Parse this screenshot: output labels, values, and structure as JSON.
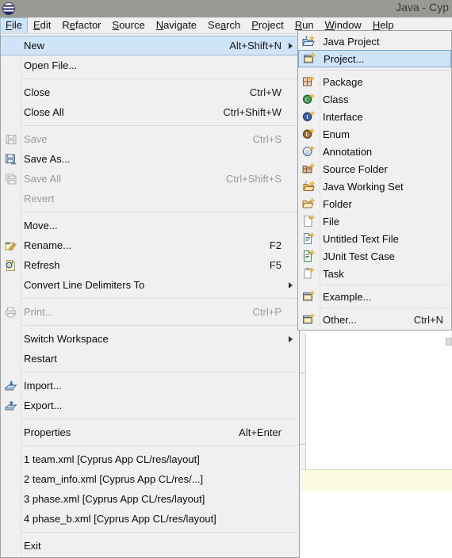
{
  "window": {
    "title": "Java - Cyp",
    "logo_icon": "eclipse-logo-icon"
  },
  "menubar": {
    "items": [
      {
        "label": "File",
        "mnemonic_index": 0,
        "active": true
      },
      {
        "label": "Edit",
        "mnemonic_index": 0,
        "active": false
      },
      {
        "label": "Refactor",
        "mnemonic_index": 1,
        "active": false
      },
      {
        "label": "Source",
        "mnemonic_index": 0,
        "active": false
      },
      {
        "label": "Navigate",
        "mnemonic_index": 0,
        "active": false
      },
      {
        "label": "Search",
        "mnemonic_index": 2,
        "active": false
      },
      {
        "label": "Project",
        "mnemonic_index": 0,
        "active": false
      },
      {
        "label": "Run",
        "mnemonic_index": 0,
        "active": false
      },
      {
        "label": "Window",
        "mnemonic_index": 0,
        "active": false
      },
      {
        "label": "Help",
        "mnemonic_index": 0,
        "active": false
      }
    ]
  },
  "file_menu": {
    "items": [
      {
        "type": "item",
        "label": "New",
        "accel": "Alt+Shift+N",
        "submenu": true,
        "enabled": true,
        "selected": true,
        "icon": ""
      },
      {
        "type": "item",
        "label": "Open File...",
        "accel": "",
        "submenu": false,
        "enabled": true,
        "selected": false,
        "icon": ""
      },
      {
        "type": "sep"
      },
      {
        "type": "item",
        "label": "Close",
        "accel": "Ctrl+W",
        "submenu": false,
        "enabled": true,
        "selected": false,
        "icon": ""
      },
      {
        "type": "item",
        "label": "Close All",
        "accel": "Ctrl+Shift+W",
        "submenu": false,
        "enabled": true,
        "selected": false,
        "icon": ""
      },
      {
        "type": "sep"
      },
      {
        "type": "item",
        "label": "Save",
        "accel": "Ctrl+S",
        "submenu": false,
        "enabled": false,
        "selected": false,
        "icon": "save-icon"
      },
      {
        "type": "item",
        "label": "Save As...",
        "accel": "",
        "submenu": false,
        "enabled": true,
        "selected": false,
        "icon": "save-as-icon"
      },
      {
        "type": "item",
        "label": "Save All",
        "accel": "Ctrl+Shift+S",
        "submenu": false,
        "enabled": false,
        "selected": false,
        "icon": "save-all-icon"
      },
      {
        "type": "item",
        "label": "Revert",
        "accel": "",
        "submenu": false,
        "enabled": false,
        "selected": false,
        "icon": ""
      },
      {
        "type": "sep"
      },
      {
        "type": "item",
        "label": "Move...",
        "accel": "",
        "submenu": false,
        "enabled": true,
        "selected": false,
        "icon": ""
      },
      {
        "type": "item",
        "label": "Rename...",
        "accel": "F2",
        "submenu": false,
        "enabled": true,
        "selected": false,
        "icon": "rename-icon"
      },
      {
        "type": "item",
        "label": "Refresh",
        "accel": "F5",
        "submenu": false,
        "enabled": true,
        "selected": false,
        "icon": "refresh-icon"
      },
      {
        "type": "item",
        "label": "Convert Line Delimiters To",
        "accel": "",
        "submenu": true,
        "enabled": true,
        "selected": false,
        "icon": ""
      },
      {
        "type": "sep"
      },
      {
        "type": "item",
        "label": "Print...",
        "accel": "Ctrl+P",
        "submenu": false,
        "enabled": false,
        "selected": false,
        "icon": "print-icon"
      },
      {
        "type": "sep"
      },
      {
        "type": "item",
        "label": "Switch Workspace",
        "accel": "",
        "submenu": true,
        "enabled": true,
        "selected": false,
        "icon": ""
      },
      {
        "type": "item",
        "label": "Restart",
        "accel": "",
        "submenu": false,
        "enabled": true,
        "selected": false,
        "icon": ""
      },
      {
        "type": "sep"
      },
      {
        "type": "item",
        "label": "Import...",
        "accel": "",
        "submenu": false,
        "enabled": true,
        "selected": false,
        "icon": "import-icon"
      },
      {
        "type": "item",
        "label": "Export...",
        "accel": "",
        "submenu": false,
        "enabled": true,
        "selected": false,
        "icon": "export-icon"
      },
      {
        "type": "sep"
      },
      {
        "type": "item",
        "label": "Properties",
        "accel": "Alt+Enter",
        "submenu": false,
        "enabled": true,
        "selected": false,
        "icon": ""
      },
      {
        "type": "sep"
      },
      {
        "type": "item",
        "label": "1 team.xml  [Cyprus App CL/res/layout]",
        "accel": "",
        "submenu": false,
        "enabled": true,
        "selected": false,
        "icon": ""
      },
      {
        "type": "item",
        "label": "2 team_info.xml  [Cyprus App CL/res/...]",
        "accel": "",
        "submenu": false,
        "enabled": true,
        "selected": false,
        "icon": ""
      },
      {
        "type": "item",
        "label": "3 phase.xml  [Cyprus App CL/res/layout]",
        "accel": "",
        "submenu": false,
        "enabled": true,
        "selected": false,
        "icon": ""
      },
      {
        "type": "item",
        "label": "4 phase_b.xml  [Cyprus App CL/res/layout]",
        "accel": "",
        "submenu": false,
        "enabled": true,
        "selected": false,
        "icon": ""
      },
      {
        "type": "sep"
      },
      {
        "type": "item",
        "label": "Exit",
        "accel": "",
        "submenu": false,
        "enabled": true,
        "selected": false,
        "icon": ""
      }
    ]
  },
  "new_submenu": {
    "items": [
      {
        "type": "item",
        "label": "Java Project",
        "accel": "",
        "selected": false,
        "icon": "java-project-icon"
      },
      {
        "type": "item",
        "label": "Project...",
        "accel": "",
        "selected": true,
        "icon": "project-icon"
      },
      {
        "type": "sep"
      },
      {
        "type": "item",
        "label": "Package",
        "accel": "",
        "selected": false,
        "icon": "package-icon"
      },
      {
        "type": "item",
        "label": "Class",
        "accel": "",
        "selected": false,
        "icon": "class-icon"
      },
      {
        "type": "item",
        "label": "Interface",
        "accel": "",
        "selected": false,
        "icon": "interface-icon"
      },
      {
        "type": "item",
        "label": "Enum",
        "accel": "",
        "selected": false,
        "icon": "enum-icon"
      },
      {
        "type": "item",
        "label": "Annotation",
        "accel": "",
        "selected": false,
        "icon": "annotation-icon"
      },
      {
        "type": "item",
        "label": "Source Folder",
        "accel": "",
        "selected": false,
        "icon": "source-folder-icon"
      },
      {
        "type": "item",
        "label": "Java Working Set",
        "accel": "",
        "selected": false,
        "icon": "java-working-set-icon"
      },
      {
        "type": "item",
        "label": "Folder",
        "accel": "",
        "selected": false,
        "icon": "folder-icon"
      },
      {
        "type": "item",
        "label": "File",
        "accel": "",
        "selected": false,
        "icon": "file-icon"
      },
      {
        "type": "item",
        "label": "Untitled Text File",
        "accel": "",
        "selected": false,
        "icon": "untitled-text-file-icon"
      },
      {
        "type": "item",
        "label": "JUnit Test Case",
        "accel": "",
        "selected": false,
        "icon": "junit-test-case-icon"
      },
      {
        "type": "item",
        "label": "Task",
        "accel": "",
        "selected": false,
        "icon": "task-icon"
      },
      {
        "type": "sep"
      },
      {
        "type": "item",
        "label": "Example...",
        "accel": "",
        "selected": false,
        "icon": "example-icon"
      },
      {
        "type": "sep"
      },
      {
        "type": "item",
        "label": "Other...",
        "accel": "Ctrl+N",
        "selected": false,
        "icon": "other-icon"
      }
    ]
  },
  "colors": {
    "titlebar_bg": "#9a9a94",
    "menu_bg": "#f0f0f0",
    "highlight_bg": "#cfe4f7",
    "highlight_border": "#7aa8d0",
    "disabled_text": "#9a9a9a",
    "editor_bg": "#ffffff",
    "console_bg": "#fbfbe4"
  }
}
